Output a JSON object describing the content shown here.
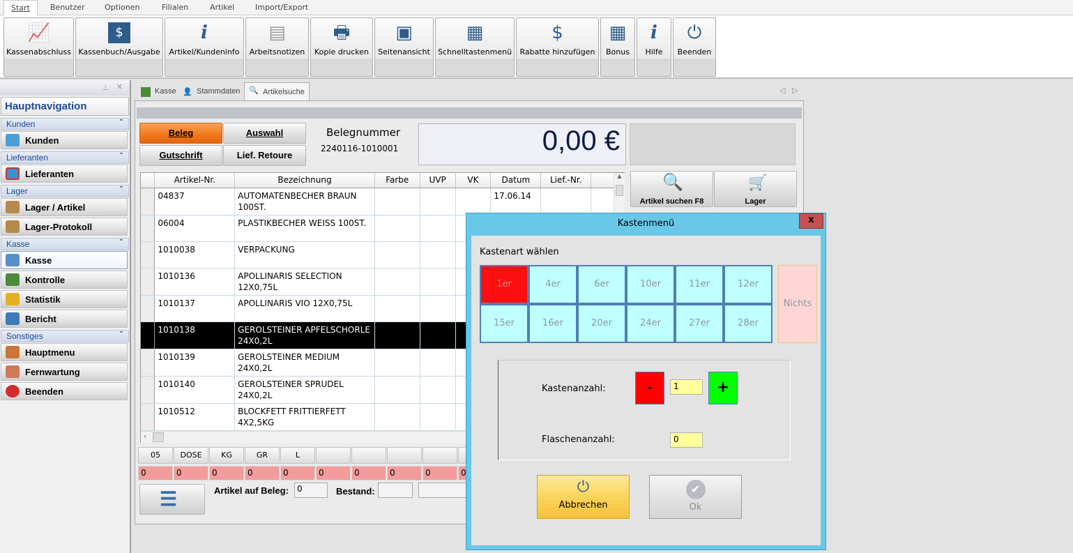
{
  "menu": {
    "tabs": [
      "Start",
      "Benutzer",
      "Optionen",
      "Filialen",
      "Artikel",
      "Import/Export"
    ],
    "active": "Start"
  },
  "ribbon": {
    "buttons": [
      {
        "label": "Kassenabschluss",
        "icon": "chart-up-icon"
      },
      {
        "label": "Kassenbuch/Ausgabe",
        "icon": "money-icon"
      },
      {
        "label": "Artikel/Kundeninfo",
        "icon": "info-icon"
      },
      {
        "label": "Arbeitsnotizen",
        "icon": "notes-icon"
      },
      {
        "label": "Kopie drucken",
        "icon": "printer-icon"
      },
      {
        "label": "Seitenansicht",
        "icon": "page-view-icon"
      },
      {
        "label": "Schnelltastenmenü",
        "icon": "grid-icon"
      },
      {
        "label": "Rabatte hinzufügen",
        "icon": "coins-icon"
      },
      {
        "label": "Bonus",
        "icon": "calculator-icon"
      },
      {
        "label": "Hilfe",
        "icon": "info-icon"
      },
      {
        "label": "Beenden",
        "icon": "power-icon"
      }
    ]
  },
  "sidebar": {
    "title": "Hauptnavigation",
    "groups": [
      {
        "label": "Kunden",
        "items": [
          "Kunden"
        ]
      },
      {
        "label": "Lieferanten",
        "items": [
          "Lieferanten"
        ]
      },
      {
        "label": "Lager",
        "items": [
          "Lager / Artikel",
          "Lager-Protokoll"
        ]
      },
      {
        "label": "Kasse",
        "items": [
          "Kasse",
          "Kontrolle",
          "Statistik",
          "Bericht"
        ]
      },
      {
        "label": "Sonstiges",
        "items": [
          "Hauptmenu",
          "Fernwartung",
          "Beenden"
        ]
      }
    ]
  },
  "doc_tabs": [
    "Kasse",
    "Stammdaten",
    "Artikelsuche"
  ],
  "receipt": {
    "beleg": "Beleg",
    "auswahl": "Auswahl",
    "gutschrift": "Gutschrift",
    "retoure": "Lief. Retoure",
    "belegnummer_label": "Belegnummer",
    "belegnummer": "2240116-1010001",
    "amount": "0,00 €"
  },
  "side_buttons": {
    "search": "Artikel suchen F8",
    "lager": "Lager"
  },
  "table": {
    "columns": [
      "Artikel-Nr.",
      "Bezeichnung",
      "Farbe",
      "UVP",
      "VK",
      "Datum",
      "Lief.-Nr."
    ],
    "rows": [
      {
        "nr": "04837",
        "bez": "AUTOMATENBECHER BRAUN 100ST.",
        "datum": "17.06.14"
      },
      {
        "nr": "06004",
        "bez": "PLASTIKBECHER WEISS 100ST.",
        "datum": ""
      },
      {
        "nr": "1010038",
        "bez": "VERPACKUNG",
        "datum": ""
      },
      {
        "nr": "1010136",
        "bez": "APOLLINARIS SELECTION 12X0,75L",
        "datum": ""
      },
      {
        "nr": "1010137",
        "bez": "APOLLINARIS  VIO  12X0,75L",
        "datum": ""
      },
      {
        "nr": "1010138",
        "bez": "GEROLSTEINER APFELSCHORLE 24X0,2L",
        "datum": "",
        "selected": true
      },
      {
        "nr": "1010139",
        "bez": "GEROLSTEINER MEDIUM 24X0,2L",
        "datum": ""
      },
      {
        "nr": "1010140",
        "bez": "GEROLSTEINER SPRUDEL 24X0,2L",
        "datum": ""
      },
      {
        "nr": "1010512",
        "bez": "BLOCKFETT FRITTIERFETT 4X2,5KG",
        "datum": ""
      }
    ]
  },
  "units": {
    "labels": [
      "05",
      "DOSE",
      "KG",
      "GR",
      "L",
      "",
      "",
      "",
      "",
      ""
    ],
    "values": [
      "0",
      "0",
      "0",
      "0",
      "0",
      "0",
      "0",
      "0",
      "0",
      "0"
    ]
  },
  "footer": {
    "artikel_label": "Artikel auf Beleg:",
    "artikel_value": "0",
    "bestand_label": "Bestand:"
  },
  "dialog": {
    "title": "Kastenmenü",
    "close": "x",
    "section": "Kastenart wählen",
    "boxes": [
      "1er",
      "4er",
      "6er",
      "10er",
      "11er",
      "12er",
      "15er",
      "16er",
      "20er",
      "24er",
      "27er",
      "28er"
    ],
    "selected": "1er",
    "nichts": "Nichts",
    "kasten_label": "Kastenanzahl:",
    "kasten_value": "1",
    "minus": "-",
    "plus": "+",
    "flaschen_label": "Flaschenanzahl:",
    "flaschen_value": "0",
    "cancel": "Abbrechen",
    "ok": "Ok"
  },
  "colors": {
    "accent_orange": "#f27b20",
    "dialog_frame": "#69c8e8",
    "box_selected": "#fe0f0f",
    "box": "#c0ffff",
    "minus": "#ff0000",
    "plus": "#00ff00",
    "input_yellow": "#ffff9c"
  }
}
